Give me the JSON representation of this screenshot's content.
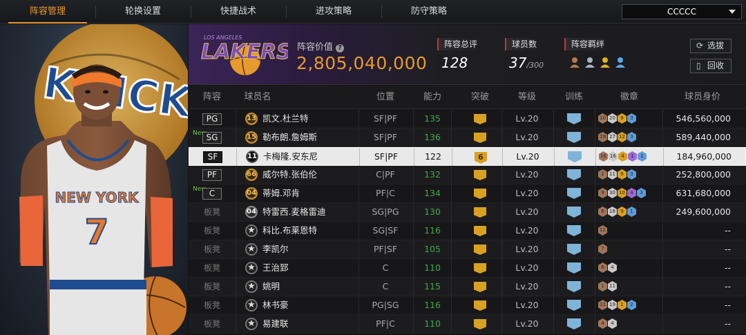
{
  "nav": {
    "tabs": [
      "阵容管理",
      "轮换设置",
      "快捷战术",
      "进攻策略",
      "防守策略"
    ],
    "active_tab": 0,
    "team_select": "CCCCC"
  },
  "player_art": {
    "team_logo": "KNICKS",
    "jersey_team": "NEW YORK",
    "jersey_number": "7"
  },
  "header": {
    "team_logo_text": "LAKERS",
    "team_logo_subtext": "LOS ANGELES",
    "value_label": "阵容价值",
    "value_num": "2,805,040,000",
    "rating_label": "阵容总评",
    "rating_val": "128",
    "players_label": "球员数",
    "players_val": "37",
    "players_max": "/300",
    "bond_label": "阵容羁绊",
    "select_btn": "选拔",
    "recycle_btn": "回收"
  },
  "table": {
    "headers": [
      "阵容",
      "球员名",
      "位置",
      "能力",
      "突破",
      "等级",
      "训练",
      "徽章",
      "球员身价"
    ],
    "rows": [
      {
        "pos": "PG",
        "new": "",
        "num": "13",
        "name": "凯文.杜兰特",
        "posn": "SF|PF",
        "ability": "135",
        "bt": "",
        "level": "Lv.20",
        "badges": [
          [
            "10",
            "bronze"
          ],
          [
            "20",
            "silver"
          ],
          [
            "9",
            "gold"
          ],
          [
            "3",
            "blue"
          ]
        ],
        "worth": "546,560,000"
      },
      {
        "pos": "SG",
        "new": "New",
        "num": "15",
        "name": "勒布朗.詹姆斯",
        "posn": "SF|PF",
        "ability": "136",
        "bt": "",
        "level": "Lv.20",
        "badges": [
          [
            "19",
            "bronze"
          ],
          [
            "27",
            "silver"
          ],
          [
            "12",
            "gold"
          ],
          [
            "3",
            "blue"
          ]
        ],
        "worth": "589,440,000"
      },
      {
        "pos": "SF",
        "new": "",
        "num": "11",
        "name": "卡梅隆.安东尼",
        "posn": "SF|PF",
        "ability": "122",
        "bt": "6",
        "level": "Lv.20",
        "badges": [
          [
            "16",
            "bronze"
          ],
          [
            "16",
            "silver"
          ],
          [
            "4",
            "gold"
          ],
          [
            "1",
            "purple"
          ],
          [
            "1",
            "blue"
          ]
        ],
        "worth": "184,960,000"
      },
      {
        "pos": "PF",
        "new": "",
        "num": "66",
        "name": "威尔特.张伯伦",
        "posn": "C|PF",
        "ability": "132",
        "bt": "",
        "level": "Lv.20",
        "badges": [
          [
            "2",
            "bronze"
          ],
          [
            "11",
            "silver"
          ],
          [
            "9",
            "gold"
          ],
          [
            "3",
            "blue"
          ]
        ],
        "worth": "252,800,000"
      },
      {
        "pos": "C",
        "new": "New",
        "num": "04",
        "name": "蒂姆.邓肯",
        "posn": "PF|C",
        "ability": "134",
        "bt": "",
        "level": "Lv.20",
        "badges": [
          [
            "9",
            "bronze"
          ],
          [
            "30",
            "silver"
          ],
          [
            "10",
            "gold"
          ],
          [
            "4",
            "purple"
          ],
          [
            "3",
            "blue"
          ]
        ],
        "worth": "631,680,000"
      },
      {
        "pos": "板凳",
        "new": "",
        "num": "04",
        "name": "特雷西.麦格雷迪",
        "posn": "SG|PG",
        "ability": "130",
        "bt": "",
        "level": "Lv.20",
        "badges": [
          [
            "6",
            "bronze"
          ],
          [
            "18",
            "silver"
          ],
          [
            "9",
            "gold"
          ],
          [
            "1",
            "blue"
          ]
        ],
        "worth": "249,600,000"
      },
      {
        "pos": "板凳",
        "new": "",
        "num": "★",
        "name": "科比.布莱恩特",
        "posn": "SG|SF",
        "ability": "116",
        "bt": "",
        "level": "Lv.20",
        "badges": [
          [
            "11",
            "bronze"
          ]
        ],
        "worth": "--"
      },
      {
        "pos": "板凳",
        "new": "",
        "num": "★",
        "name": "李凯尔",
        "posn": "PF|SF",
        "ability": "105",
        "bt": "",
        "level": "Lv.20",
        "badges": [
          [
            "7",
            "bronze"
          ]
        ],
        "worth": "--"
      },
      {
        "pos": "板凳",
        "new": "",
        "num": "★",
        "name": "王治郅",
        "posn": "C",
        "ability": "110",
        "bt": "",
        "level": "Lv.20",
        "badges": [
          [
            "6",
            "bronze"
          ],
          [
            "4",
            "silver"
          ]
        ],
        "worth": "--"
      },
      {
        "pos": "板凳",
        "new": "",
        "num": "★",
        "name": "姚明",
        "posn": "C",
        "ability": "115",
        "bt": "",
        "level": "Lv.20",
        "badges": [
          [
            "1",
            "bronze"
          ],
          [
            "11",
            "silver"
          ]
        ],
        "worth": "--"
      },
      {
        "pos": "板凳",
        "new": "",
        "num": "★",
        "name": "林书豪",
        "posn": "PG|SG",
        "ability": "116",
        "bt": "",
        "level": "Lv.20",
        "badges": [
          [
            "11",
            "bronze"
          ],
          [
            "19",
            "silver"
          ],
          [
            "1",
            "gold"
          ],
          [
            "2",
            "blue"
          ]
        ],
        "worth": "--"
      },
      {
        "pos": "板凳",
        "new": "",
        "num": "★",
        "name": "易建联",
        "posn": "PF|C",
        "ability": "110",
        "bt": "",
        "level": "Lv.20",
        "badges": [
          [
            "4",
            "bronze"
          ],
          [
            "4",
            "silver"
          ]
        ],
        "worth": "--"
      }
    ]
  }
}
